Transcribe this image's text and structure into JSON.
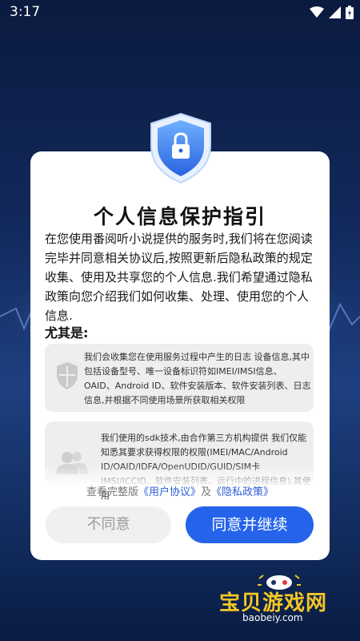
{
  "status_bar": {
    "time": "3:17"
  },
  "dialog": {
    "title": "个人信息保护指引",
    "intro": "在您使用番阅听小说提供的服务时,我们将在您阅读完毕并同意相关协议后,按照更新后隐私政策的规定收集、使用及共享您的个人信息.我们希望通过隐私政策向您介绍我们如何收集、处理、使用您的个人信息.",
    "highlight": "尤其是:",
    "cards": [
      {
        "icon": "shield-icon",
        "text": "我们会收集您在使用服务过程中产生的日志 设备信息,其中包括设备型号、唯一设备标识符如IMEI/IMSI信息、OAID、Android ID、软件安装版本、软件安装列表、日志信息,并根据不同使用场景所获取相关权限"
      },
      {
        "icon": "users-icon",
        "text": "我们使用的sdk技术,由合作第三方机构提供 我们仅能知悉其要求获得权限的权限(IMEI/MAC/Android ID/OAID/IDFA/OpenUDID/GUID/SIM卡IMSI/ICCID、软件安装列表、运行中的进程信息),其使用"
      }
    ],
    "links": {
      "prefix": "查看完整版",
      "user_agreement": "《用户协议》",
      "and": "及",
      "privacy_policy": "《隐私政策》"
    },
    "decline_label": "不同意",
    "agree_label": "同意并继续"
  },
  "watermark": {
    "text": "宝贝游戏网",
    "url": "baobeiy.com"
  },
  "colors": {
    "accent": "#2563ea",
    "watermark": "#f3c623"
  }
}
